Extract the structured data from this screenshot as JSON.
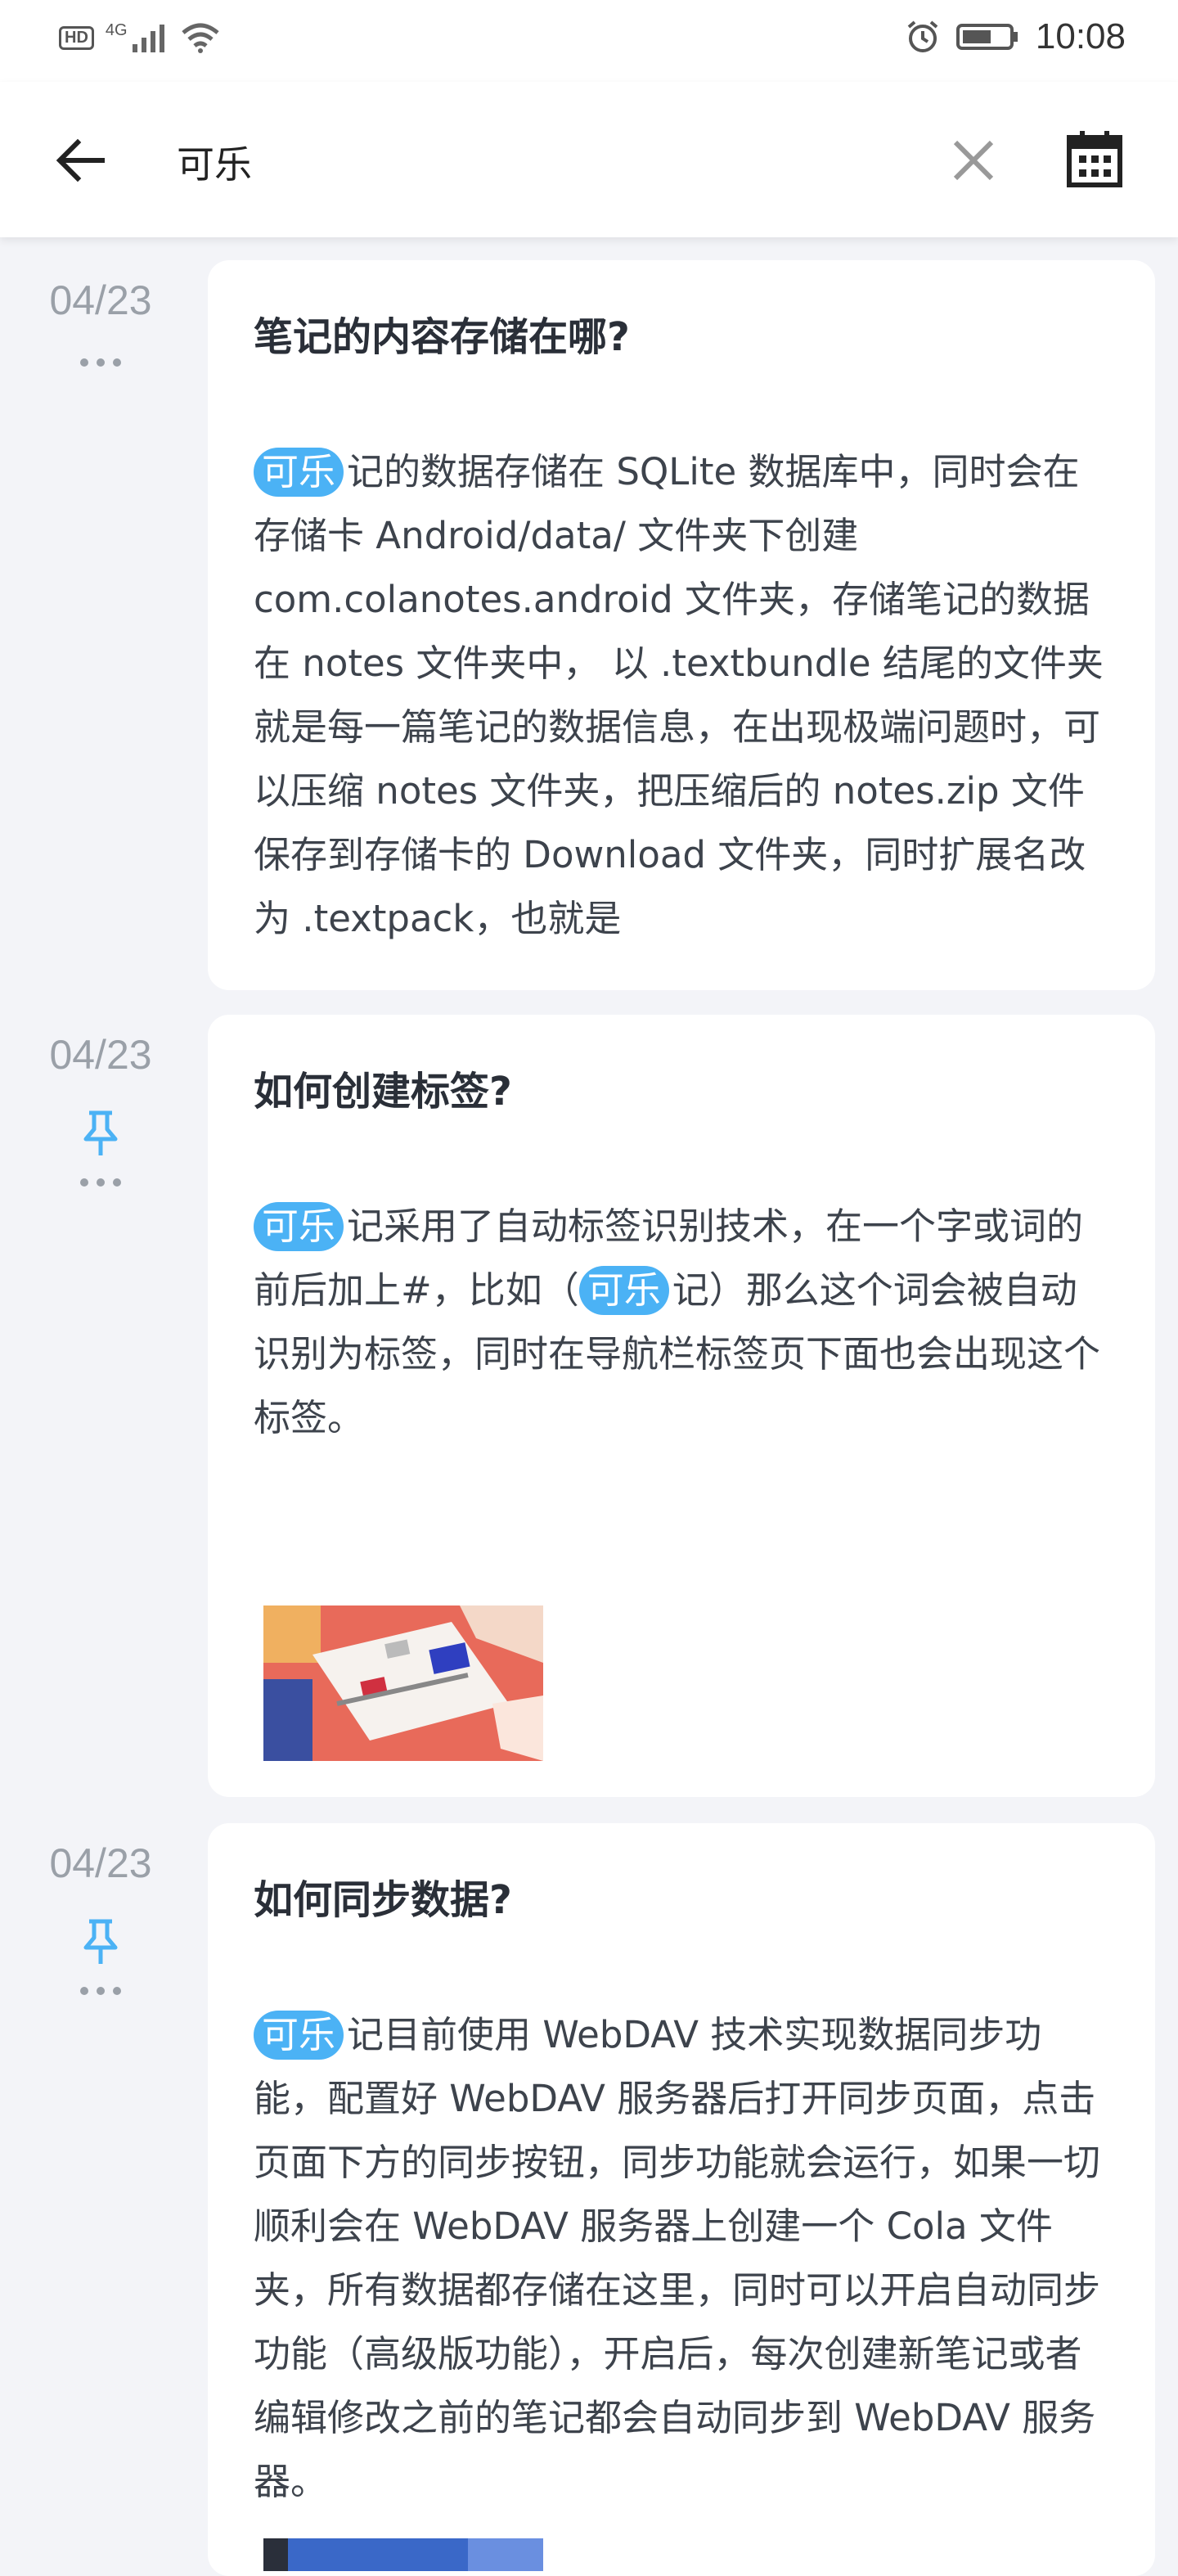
{
  "status_bar": {
    "hd": "HD",
    "network": "4G",
    "time": "10:08"
  },
  "header": {
    "search_value": "可乐",
    "icons": [
      "back-arrow-icon",
      "clear-x-icon",
      "calendar-icon"
    ]
  },
  "notes": [
    {
      "date": "04/23",
      "pinned": false,
      "title": "笔记的内容存储在哪?",
      "highlight": "可乐",
      "body": "记的数据存储在 SQLite 数据库中，同时会在存储卡 Android/data/ 文件夹下创建 com.colanotes.android 文件夹，存储笔记的数据在 notes 文件夹中， 以 .textbundle 结尾的文件夹就是每一篇笔记的数据信息，在出现极端问题时，可以压缩 notes 文件夹，把压缩后的 notes.zip 文件保存到存储卡的 Download 文件夹，同时扩展名改为 .textpack，也就是"
    },
    {
      "date": "04/23",
      "pinned": true,
      "title": "如何创建标签?",
      "highlight": "可乐",
      "body_a": "记采用了自动标签识别技术，在一个字或词的前后加上#，比如（",
      "highlight_b": "可乐",
      "body_b": "记）那么这个词会被自动识别为标签，同时在导航栏标签页下面也会出现这个标签。"
    },
    {
      "date": "04/23",
      "pinned": true,
      "title": "如何同步数据?",
      "highlight": "可乐",
      "body": "记目前使用 WebDAV 技术实现数据同步功能，配置好 WebDAV 服务器后打开同步页面，点击页面下方的同步按钮，同步功能就会运行，如果一切顺利会在 WebDAV 服务器上创建一个 Cola 文件夹，所有数据都存储在这里，同时可以开启自动同步功能（高级版功能），开启后，每次创建新笔记或者编辑修改之前的笔记都会自动同步到 WebDAV 服务器。"
    }
  ],
  "colors": {
    "accent": "#4bb2f5",
    "background": "#f3f4f8",
    "card": "#ffffff",
    "date": "#9aa0a8"
  }
}
